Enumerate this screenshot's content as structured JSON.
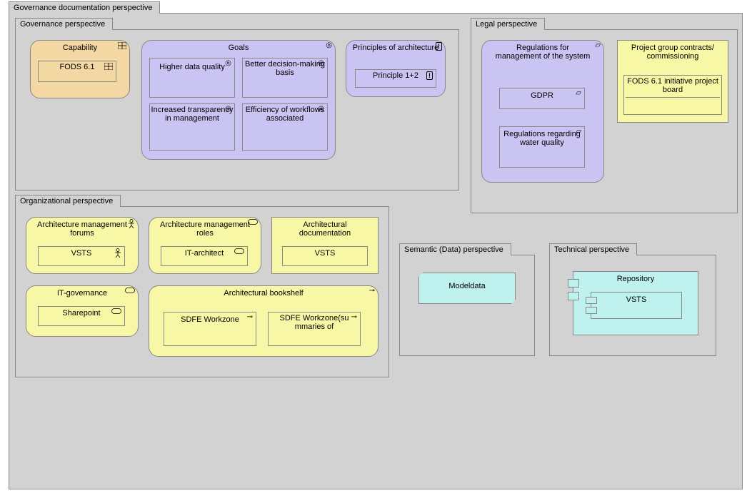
{
  "root": {
    "title": "Governance documentation perspective"
  },
  "governance": {
    "title": "Governance perspective",
    "capability": {
      "label": "Capability",
      "child": "FODS 6.1"
    },
    "goals": {
      "label": "Goals",
      "items": [
        "Higher data quality",
        "Better decision-making basis",
        "Increased transparency in management",
        "Efficiency of workflows associated"
      ]
    },
    "principles": {
      "label": "Principles of architecture",
      "child": "Principle 1+2"
    }
  },
  "legal": {
    "title": "Legal perspective",
    "regs": {
      "label": "Regulations for management of the system",
      "items": [
        "GDPR",
        "Regulations regarding water quality"
      ]
    },
    "contracts": {
      "label": "Project group contracts/ commissioning",
      "child": "FODS 6.1 initiative project board"
    }
  },
  "org": {
    "title": "Organizational perspective",
    "forums": {
      "label": "Architecture management forums",
      "child": "VSTS"
    },
    "roles": {
      "label": "Architecture management roles",
      "child": "IT-architect"
    },
    "docs": {
      "label": "Architectural documentation",
      "child": "VSTS"
    },
    "itgov": {
      "label": "IT-governance",
      "child": "Sharepoint"
    },
    "bookshelf": {
      "label": "Architectural bookshelf",
      "items": [
        "SDFE Workzone",
        "SDFE Workzone(su mmaries of"
      ]
    }
  },
  "semantic": {
    "title": "Semantic (Data) perspective",
    "item": "Modeldata"
  },
  "technical": {
    "title": "Technical perspective",
    "repo": {
      "label": "Repository",
      "child": "VSTS"
    }
  }
}
